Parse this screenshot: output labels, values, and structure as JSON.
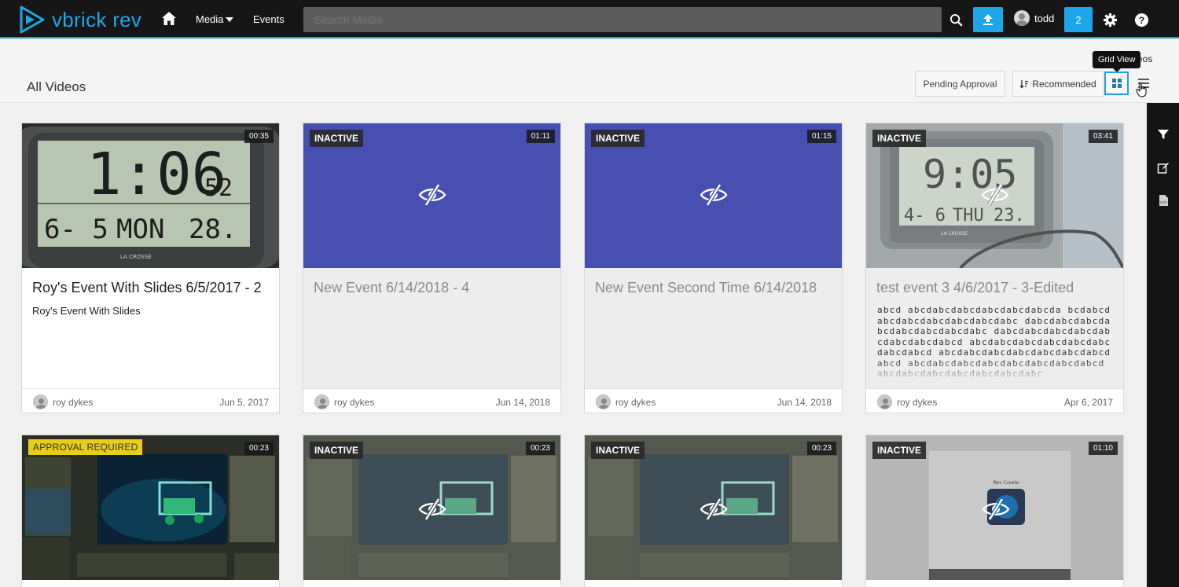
{
  "nav": {
    "logo_text": "vbrick rev",
    "media_label": "Media",
    "events_label": "Events",
    "search_placeholder": "Search Media",
    "username": "todd",
    "notification_count": "2"
  },
  "header": {
    "page_title": "All Videos",
    "count_fragment": "eos",
    "tooltip": "Grid View",
    "pending_label": "Pending Approval",
    "sort_label": "Recommended"
  },
  "cards": [
    {
      "title": "Roy's Event With Slides 6/5/2017 - 2",
      "description": "Roy's Event With Slides",
      "author": "roy dykes",
      "date": "Jun 5, 2017",
      "duration": "00:35",
      "badge": ""
    },
    {
      "title": "New Event 6/14/2018 - 4",
      "description": "",
      "author": "roy dykes",
      "date": "Jun 14, 2018",
      "duration": "01:11",
      "badge": "INACTIVE"
    },
    {
      "title": "New Event Second Time 6/14/2018",
      "description": "",
      "author": "roy dykes",
      "date": "Jun 14, 2018",
      "duration": "01:15",
      "badge": "INACTIVE"
    },
    {
      "title": "test event 3 4/6/2017 - 3-Edited",
      "description": "abcd abcdabcdabcdabcdabcdabcda bcdabcdabcdabcdabcdabcdabcdabc dabcdabcdabcdabcdabcdabcdabcdabc dabcdabcdabcdabcdabcdabcdabcdabcd abcdabcdabcdabcdabcdabcdabcdabcd abcdabcdabcdabcdabcdabcdabcdabcd abcdabcdabcdabcdabcdabcdabcdabcd abcdabcdabcdabcdabcdabcdabc",
      "author": "roy dykes",
      "date": "Apr 6, 2017",
      "duration": "03:41",
      "badge": "INACTIVE"
    },
    {
      "title": "",
      "author": "",
      "date": "",
      "duration": "00:23",
      "badge": "APPROVAL REQUIRED"
    },
    {
      "title": "",
      "author": "",
      "date": "",
      "duration": "00:23",
      "badge": "INACTIVE"
    },
    {
      "title": "",
      "author": "",
      "date": "",
      "duration": "00:23",
      "badge": "INACTIVE"
    },
    {
      "title": "",
      "author": "",
      "date": "",
      "duration": "01:10",
      "badge": "INACTIVE"
    }
  ],
  "clock1": {
    "time": "1:06",
    "sec": "52",
    "date": "6- 5",
    "day": "MON",
    "temp": "28.",
    "brand": "LA CROSSE"
  },
  "clock2": {
    "time": "9:05",
    "date": "4- 6",
    "day": "THU",
    "temp": "23.",
    "brand": "LA CROSSE"
  },
  "rov_app_title": "Rev Create",
  "colors": {
    "accent": "#1ea7e8",
    "inactive_blue": "#4750b0",
    "approval_yellow": "#e8cd1a"
  },
  "icons": [
    "home-icon",
    "search-icon",
    "upload-icon",
    "user-icon",
    "gear-icon",
    "help-icon",
    "grid-icon",
    "list-icon",
    "filter-icon",
    "edit-icon",
    "csv-file-icon",
    "eye-slash-icon"
  ]
}
